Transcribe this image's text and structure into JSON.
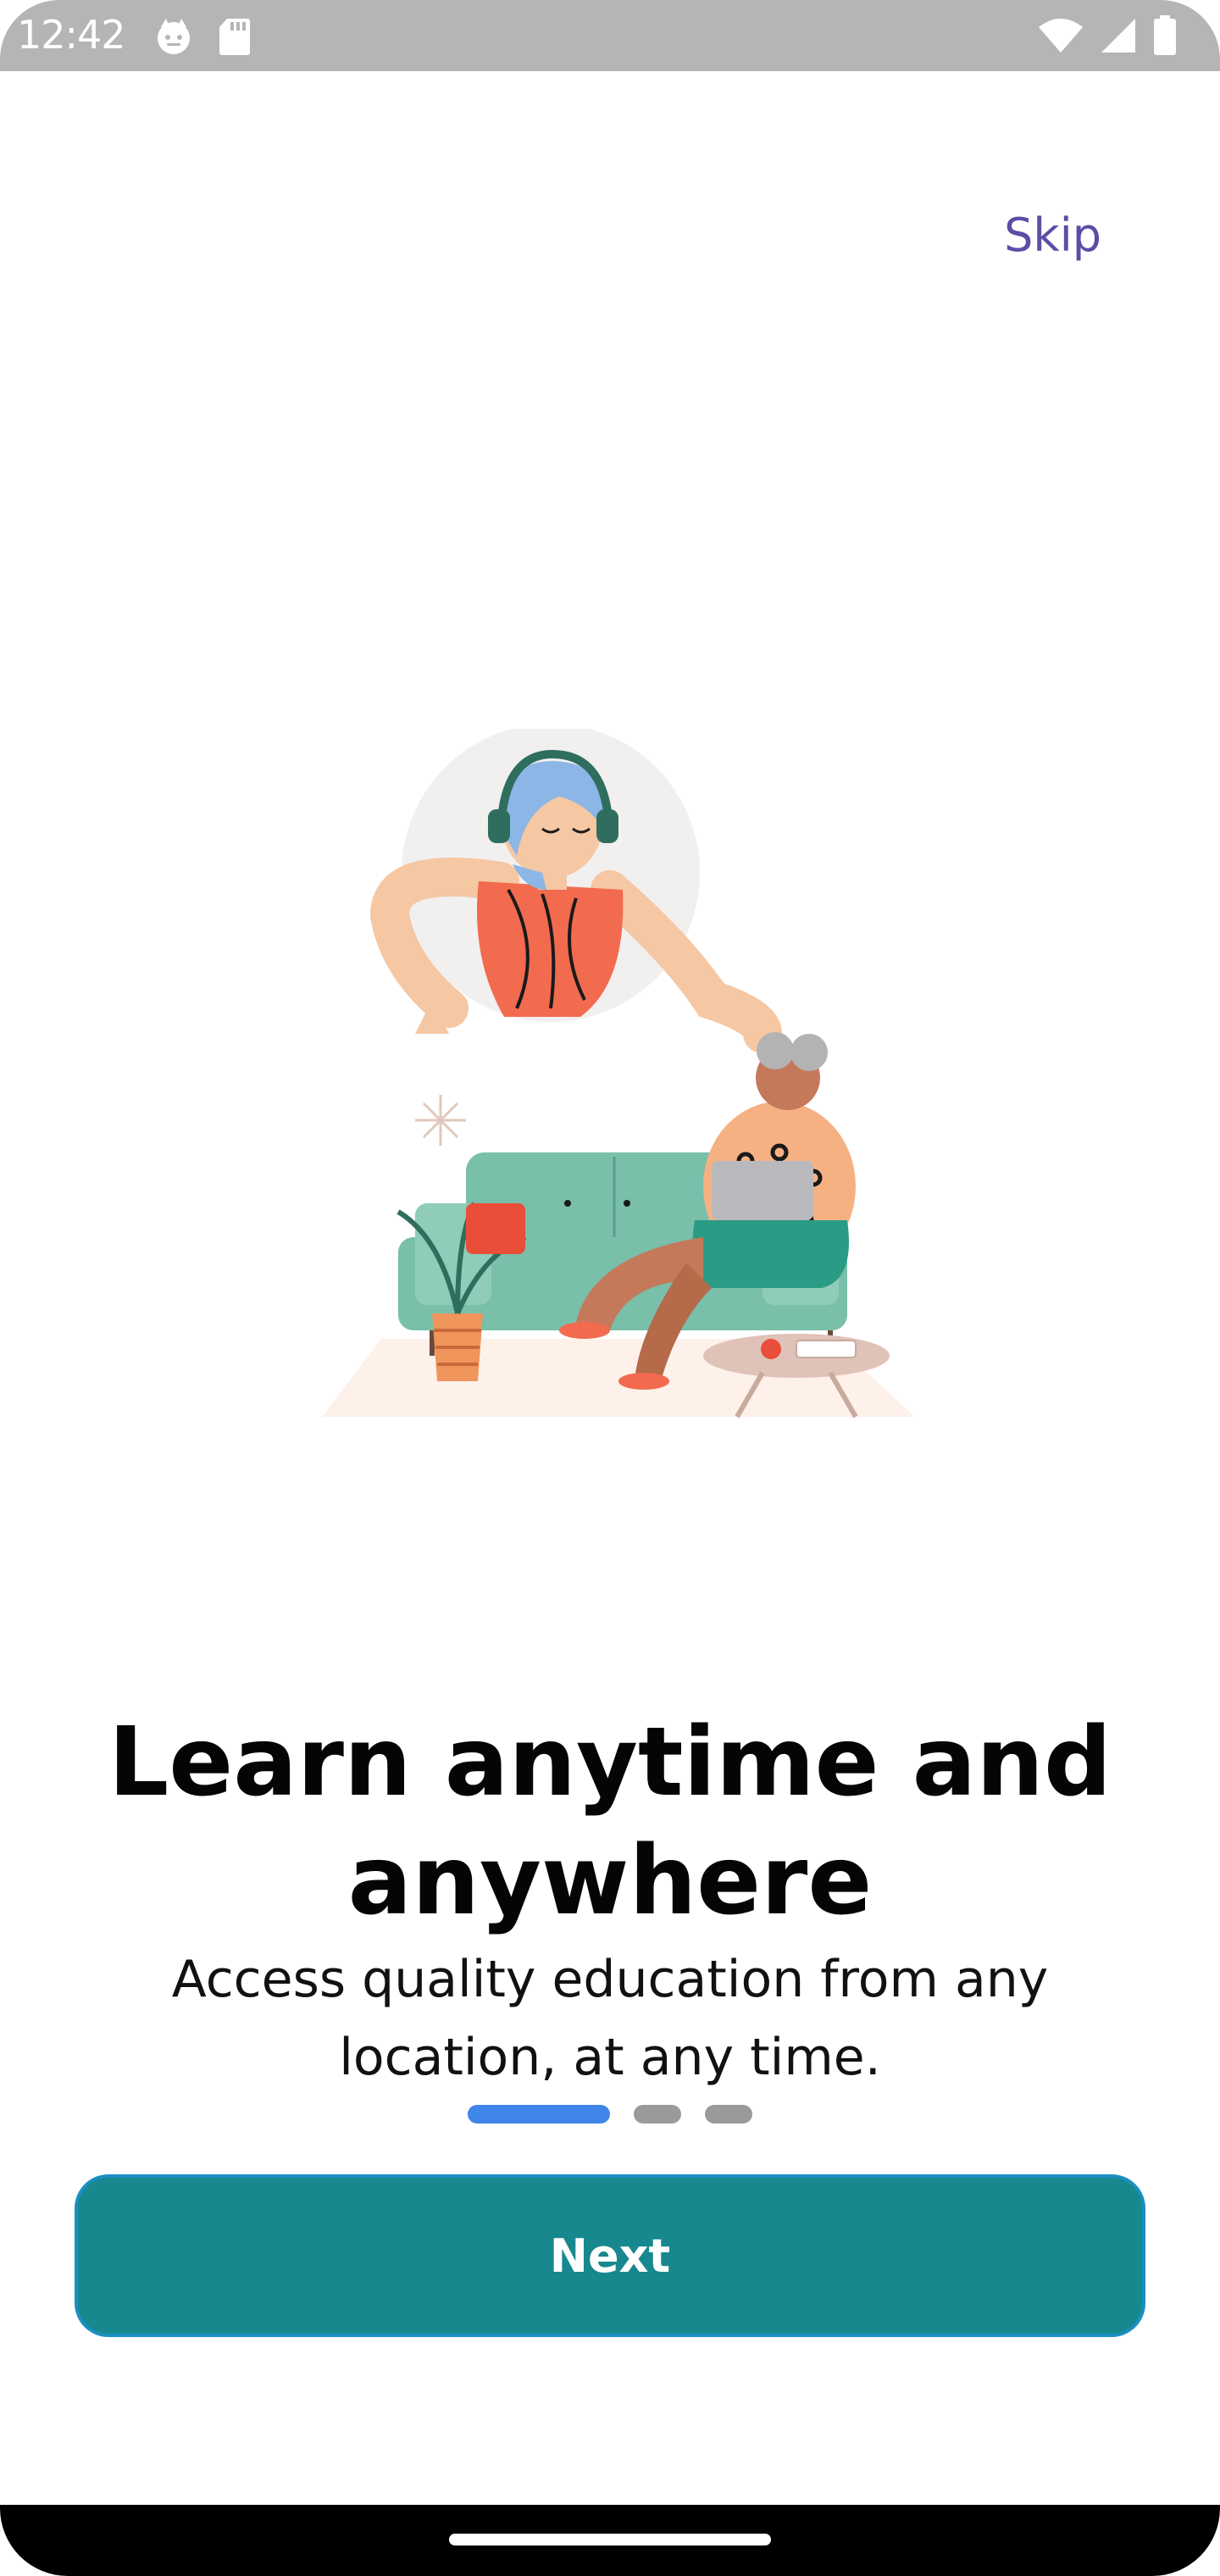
{
  "status_bar": {
    "time": "12:42",
    "icons": [
      "cat-face-icon",
      "sd-card-icon",
      "wifi-icon",
      "cell-signal-icon",
      "battery-icon"
    ],
    "background": "#b5b5b5"
  },
  "onboarding": {
    "skip_label": "Skip",
    "illustration": "person-with-headphones-and-woman-on-sofa-with-laptop",
    "title": "Learn anytime and anywhere",
    "subtitle": "Access quality education from any location, at any time.",
    "page_indicator": {
      "total": 3,
      "current": 1
    },
    "next_label": "Next"
  },
  "colors": {
    "accent": "#17888e",
    "skip_text": "#5a4ea6",
    "indicator_active": "#3f86e8",
    "indicator_inactive": "#9a9a9a"
  }
}
